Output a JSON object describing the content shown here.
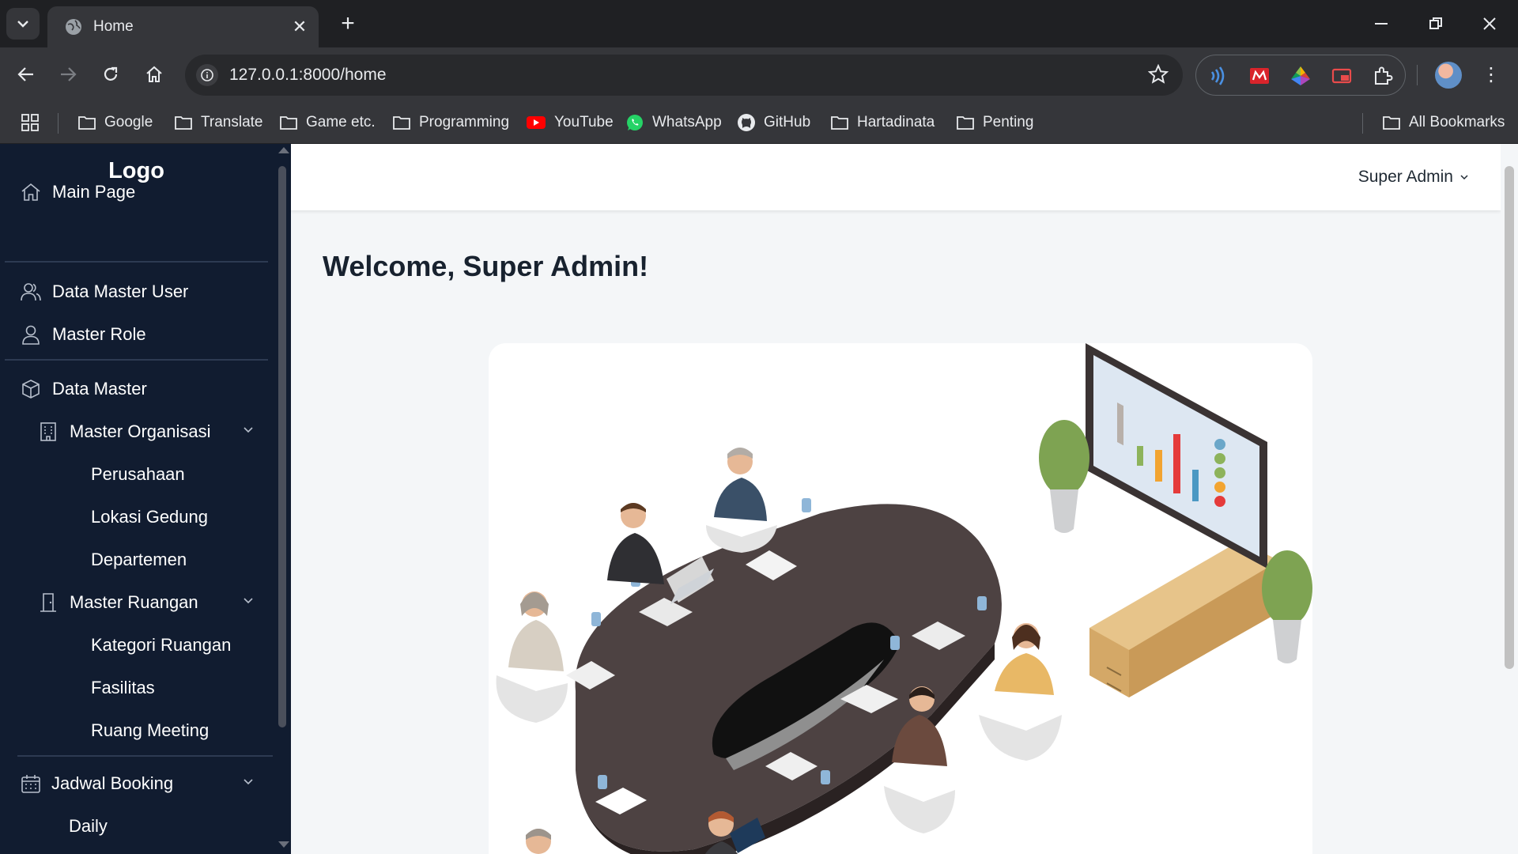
{
  "browser": {
    "tab_title": "Home",
    "url": "127.0.0.1:8000/home",
    "bookmarks": [
      {
        "label": "Google",
        "icon": "folder-icon"
      },
      {
        "label": "Translate",
        "icon": "folder-icon"
      },
      {
        "label": "Game etc.",
        "icon": "folder-icon"
      },
      {
        "label": "Programming",
        "icon": "folder-icon"
      },
      {
        "label": "YouTube",
        "icon": "youtube-icon"
      },
      {
        "label": "WhatsApp",
        "icon": "whatsapp-icon"
      },
      {
        "label": "GitHub",
        "icon": "github-icon"
      },
      {
        "label": "Hartadinata",
        "icon": "folder-icon"
      },
      {
        "label": "Penting",
        "icon": "folder-icon"
      }
    ],
    "all_bookmarks": "All Bookmarks"
  },
  "sidebar": {
    "logo": "Logo",
    "items": [
      {
        "label": "Main Page",
        "icon": "home-icon"
      },
      {
        "label": "Data Master User",
        "icon": "users-icon"
      },
      {
        "label": "Master Role",
        "icon": "user-icon"
      },
      {
        "label": "Data Master",
        "icon": "cube-icon"
      },
      {
        "label": "Master Organisasi",
        "icon": "building-icon"
      },
      {
        "label": "Perusahaan"
      },
      {
        "label": "Lokasi Gedung"
      },
      {
        "label": "Departemen"
      },
      {
        "label": "Master Ruangan",
        "icon": "door-icon"
      },
      {
        "label": "Kategori Ruangan"
      },
      {
        "label": "Fasilitas"
      },
      {
        "label": "Ruang Meeting"
      },
      {
        "label": "Jadwal Booking",
        "icon": "calendar-icon"
      },
      {
        "label": "Daily"
      }
    ]
  },
  "header": {
    "user": "Super Admin"
  },
  "main": {
    "welcome": "Welcome, Super Admin!"
  },
  "colors": {
    "sidebar_bg": "#111c30",
    "page_bg": "#f4f6f8",
    "chrome_bg": "#35363a"
  }
}
